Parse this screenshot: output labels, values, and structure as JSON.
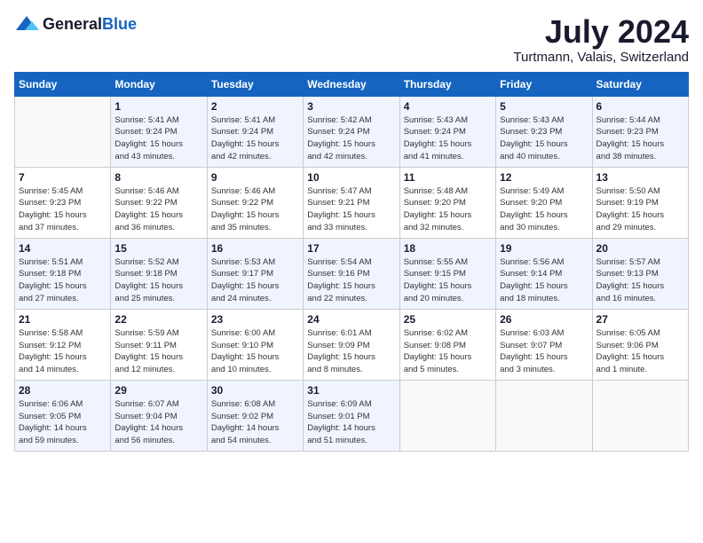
{
  "header": {
    "logo_general": "General",
    "logo_blue": "Blue",
    "month_year": "July 2024",
    "location": "Turtmann, Valais, Switzerland"
  },
  "days_of_week": [
    "Sunday",
    "Monday",
    "Tuesday",
    "Wednesday",
    "Thursday",
    "Friday",
    "Saturday"
  ],
  "weeks": [
    [
      {
        "day": "",
        "info": ""
      },
      {
        "day": "1",
        "info": "Sunrise: 5:41 AM\nSunset: 9:24 PM\nDaylight: 15 hours\nand 43 minutes."
      },
      {
        "day": "2",
        "info": "Sunrise: 5:41 AM\nSunset: 9:24 PM\nDaylight: 15 hours\nand 42 minutes."
      },
      {
        "day": "3",
        "info": "Sunrise: 5:42 AM\nSunset: 9:24 PM\nDaylight: 15 hours\nand 42 minutes."
      },
      {
        "day": "4",
        "info": "Sunrise: 5:43 AM\nSunset: 9:24 PM\nDaylight: 15 hours\nand 41 minutes."
      },
      {
        "day": "5",
        "info": "Sunrise: 5:43 AM\nSunset: 9:23 PM\nDaylight: 15 hours\nand 40 minutes."
      },
      {
        "day": "6",
        "info": "Sunrise: 5:44 AM\nSunset: 9:23 PM\nDaylight: 15 hours\nand 38 minutes."
      }
    ],
    [
      {
        "day": "7",
        "info": "Sunrise: 5:45 AM\nSunset: 9:23 PM\nDaylight: 15 hours\nand 37 minutes."
      },
      {
        "day": "8",
        "info": "Sunrise: 5:46 AM\nSunset: 9:22 PM\nDaylight: 15 hours\nand 36 minutes."
      },
      {
        "day": "9",
        "info": "Sunrise: 5:46 AM\nSunset: 9:22 PM\nDaylight: 15 hours\nand 35 minutes."
      },
      {
        "day": "10",
        "info": "Sunrise: 5:47 AM\nSunset: 9:21 PM\nDaylight: 15 hours\nand 33 minutes."
      },
      {
        "day": "11",
        "info": "Sunrise: 5:48 AM\nSunset: 9:20 PM\nDaylight: 15 hours\nand 32 minutes."
      },
      {
        "day": "12",
        "info": "Sunrise: 5:49 AM\nSunset: 9:20 PM\nDaylight: 15 hours\nand 30 minutes."
      },
      {
        "day": "13",
        "info": "Sunrise: 5:50 AM\nSunset: 9:19 PM\nDaylight: 15 hours\nand 29 minutes."
      }
    ],
    [
      {
        "day": "14",
        "info": "Sunrise: 5:51 AM\nSunset: 9:18 PM\nDaylight: 15 hours\nand 27 minutes."
      },
      {
        "day": "15",
        "info": "Sunrise: 5:52 AM\nSunset: 9:18 PM\nDaylight: 15 hours\nand 25 minutes."
      },
      {
        "day": "16",
        "info": "Sunrise: 5:53 AM\nSunset: 9:17 PM\nDaylight: 15 hours\nand 24 minutes."
      },
      {
        "day": "17",
        "info": "Sunrise: 5:54 AM\nSunset: 9:16 PM\nDaylight: 15 hours\nand 22 minutes."
      },
      {
        "day": "18",
        "info": "Sunrise: 5:55 AM\nSunset: 9:15 PM\nDaylight: 15 hours\nand 20 minutes."
      },
      {
        "day": "19",
        "info": "Sunrise: 5:56 AM\nSunset: 9:14 PM\nDaylight: 15 hours\nand 18 minutes."
      },
      {
        "day": "20",
        "info": "Sunrise: 5:57 AM\nSunset: 9:13 PM\nDaylight: 15 hours\nand 16 minutes."
      }
    ],
    [
      {
        "day": "21",
        "info": "Sunrise: 5:58 AM\nSunset: 9:12 PM\nDaylight: 15 hours\nand 14 minutes."
      },
      {
        "day": "22",
        "info": "Sunrise: 5:59 AM\nSunset: 9:11 PM\nDaylight: 15 hours\nand 12 minutes."
      },
      {
        "day": "23",
        "info": "Sunrise: 6:00 AM\nSunset: 9:10 PM\nDaylight: 15 hours\nand 10 minutes."
      },
      {
        "day": "24",
        "info": "Sunrise: 6:01 AM\nSunset: 9:09 PM\nDaylight: 15 hours\nand 8 minutes."
      },
      {
        "day": "25",
        "info": "Sunrise: 6:02 AM\nSunset: 9:08 PM\nDaylight: 15 hours\nand 5 minutes."
      },
      {
        "day": "26",
        "info": "Sunrise: 6:03 AM\nSunset: 9:07 PM\nDaylight: 15 hours\nand 3 minutes."
      },
      {
        "day": "27",
        "info": "Sunrise: 6:05 AM\nSunset: 9:06 PM\nDaylight: 15 hours\nand 1 minute."
      }
    ],
    [
      {
        "day": "28",
        "info": "Sunrise: 6:06 AM\nSunset: 9:05 PM\nDaylight: 14 hours\nand 59 minutes."
      },
      {
        "day": "29",
        "info": "Sunrise: 6:07 AM\nSunset: 9:04 PM\nDaylight: 14 hours\nand 56 minutes."
      },
      {
        "day": "30",
        "info": "Sunrise: 6:08 AM\nSunset: 9:02 PM\nDaylight: 14 hours\nand 54 minutes."
      },
      {
        "day": "31",
        "info": "Sunrise: 6:09 AM\nSunset: 9:01 PM\nDaylight: 14 hours\nand 51 minutes."
      },
      {
        "day": "",
        "info": ""
      },
      {
        "day": "",
        "info": ""
      },
      {
        "day": "",
        "info": ""
      }
    ]
  ]
}
